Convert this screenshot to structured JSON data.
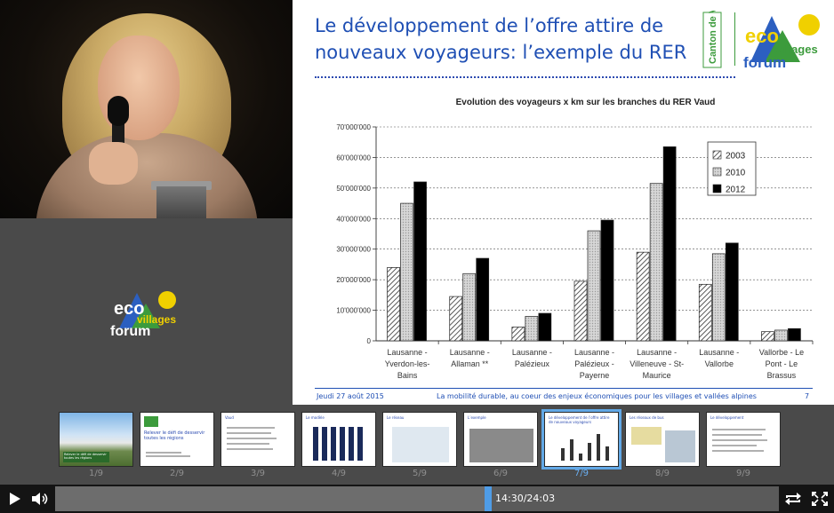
{
  "slide": {
    "title": "Le développement de l’offre attire de nouveaux voyageurs: l’exemple du RER",
    "footer_date": "Jeudi 27 août 2015",
    "footer_text": "La mobilité durable, au coeur des enjeux économiques pour les villages et vallées alpines",
    "page_number": "7",
    "vaud_logo_text": "Canton de Vaud",
    "eco_logo": {
      "eco": "eco",
      "villages": "villages",
      "forum": "forum"
    }
  },
  "chart_data": {
    "type": "bar",
    "title": "Evolution des voyageurs x km sur les branches du RER Vaud",
    "categories": [
      [
        "Lausanne -",
        "Yverdon-les-",
        "Bains"
      ],
      [
        "Lausanne -",
        "Allaman **"
      ],
      [
        "Lausanne -",
        "Palézieux"
      ],
      [
        "Lausanne -",
        "Palézieux -",
        "Payerne"
      ],
      [
        "Lausanne -",
        "Villeneuve - St-",
        "Maurice"
      ],
      [
        "Lausanne -",
        "Vallorbe"
      ],
      [
        "Vallorbe - Le",
        "Pont - Le",
        "Brassus"
      ]
    ],
    "series": [
      {
        "name": "2003",
        "pattern": "hatch",
        "values": [
          24000000,
          14500000,
          4500000,
          19500000,
          29000000,
          18500000,
          3000000
        ]
      },
      {
        "name": "2010",
        "pattern": "dotted",
        "values": [
          45000000,
          22000000,
          8000000,
          36000000,
          51500000,
          28500000,
          3500000
        ]
      },
      {
        "name": "2012",
        "pattern": "solid",
        "values": [
          52000000,
          27000000,
          9000000,
          39500000,
          63500000,
          32000000,
          4000000
        ]
      }
    ],
    "yticks": [
      "0",
      "10'000'000",
      "20'000'000",
      "30'000'000",
      "40'000'000",
      "50'000'000",
      "60'000'000",
      "70'000'000"
    ],
    "ylim": [
      0,
      70000000
    ],
    "grid": true,
    "legend_placement": "top-right"
  },
  "thumbnails": [
    {
      "number": "1/9",
      "title": "Relever le défi de desservir toutes les régions",
      "active": false
    },
    {
      "number": "2/9",
      "title": "Relever le défi de desservir toutes les régions",
      "active": false
    },
    {
      "number": "3/9",
      "title": "Vaud",
      "active": false
    },
    {
      "number": "4/9",
      "title": "Le modèle",
      "active": false
    },
    {
      "number": "5/9",
      "title": "Le réseau",
      "active": false
    },
    {
      "number": "6/9",
      "title": "L’exemple",
      "active": false
    },
    {
      "number": "7/9",
      "title": "Le développement de l’offre attire de nouveaux voyageurs",
      "active": true
    },
    {
      "number": "8/9",
      "title": "Les réseaux de bus",
      "active": false
    },
    {
      "number": "9/9",
      "title": "Le développement",
      "active": false
    }
  ],
  "player": {
    "time": "14:30/24:03",
    "progress": 0.603
  },
  "colors": {
    "title_blue": "#1f4fb4",
    "eco_green": "#3c9b3c",
    "eco_yellow": "#f0d000",
    "eco_blue": "#2c5fc0",
    "progress_blue": "#4f9ce6",
    "active_thumb": "#62a8e6"
  }
}
